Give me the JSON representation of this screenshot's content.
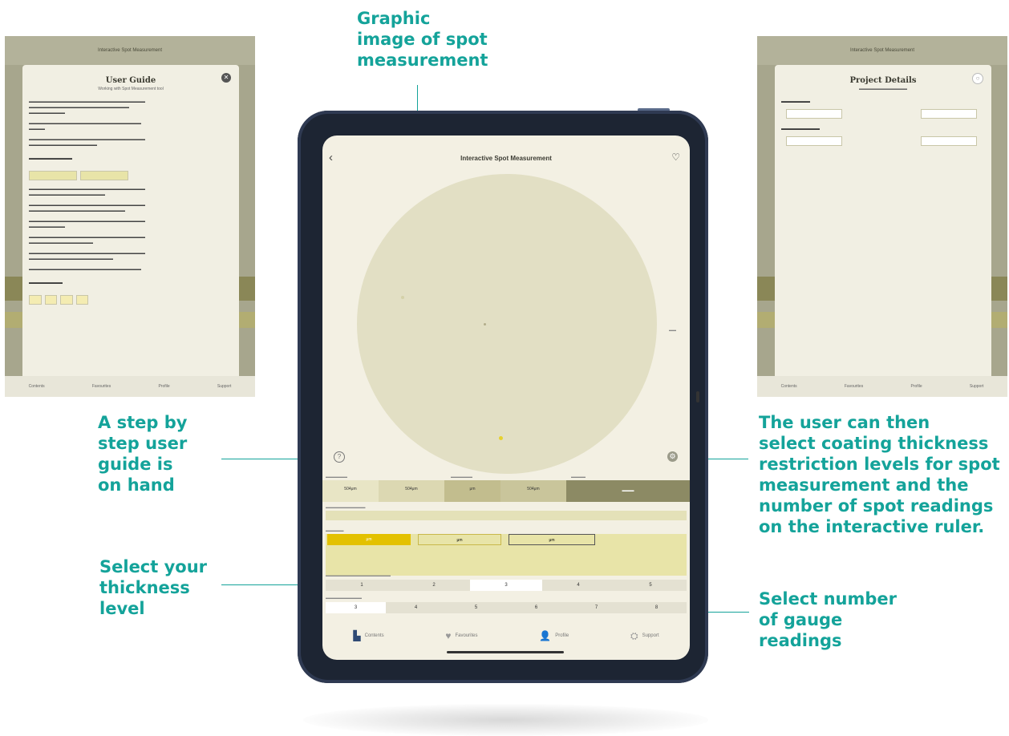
{
  "callouts": {
    "graphic": [
      "Graphic",
      "image of spot",
      "measurement"
    ],
    "guide": [
      "A step by",
      "step user",
      "guide is",
      "on hand"
    ],
    "thickness": [
      "Select your",
      "thickness",
      "level"
    ],
    "restriction": [
      "The user can then",
      "select coating thickness",
      "restriction levels for spot",
      "measurement and the",
      "number of spot readings",
      "on the interactive ruler."
    ],
    "gauge": [
      "Select number",
      "of gauge",
      "readings"
    ]
  },
  "app": {
    "title": "Interactive Spot Measurement",
    "spec": {
      "low": "504μm",
      "high": "504μm",
      "res_low": "μm",
      "res_high": "504μm"
    },
    "thickness_levels": [
      "1",
      "2",
      "3",
      "4",
      "5"
    ],
    "selected_level": "3",
    "gauge_counts": [
      "3",
      "4",
      "5",
      "6",
      "7",
      "8"
    ],
    "selected_gauge": "3",
    "gauge_values": [
      "μm",
      "μm",
      "μm"
    ],
    "tabs": [
      "Contents",
      "Favourites",
      "Profile",
      "Support"
    ]
  },
  "colors": {
    "accent": "#14a39a",
    "screen_bg": "#f3f0e3",
    "circle": "#e2dfc4",
    "olive": "#8c8a64",
    "yellow": "#e3c100"
  },
  "left_panel": {
    "title": "User Guide",
    "subtitle": "Working with Spot Measurement tool"
  },
  "right_panel": {
    "title": "Project Details"
  }
}
